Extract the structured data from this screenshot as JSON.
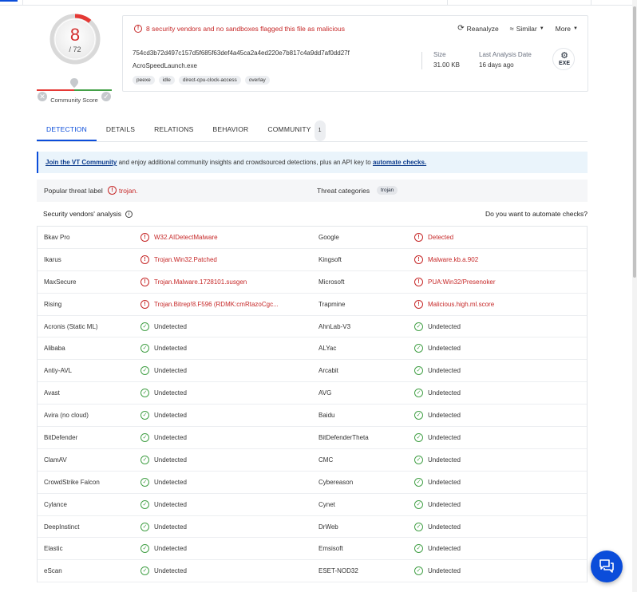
{
  "colors": {
    "accent": "#0b4dda",
    "malicious": "#c62828",
    "clean": "#43a047"
  },
  "score": {
    "value": "8",
    "total": "/ 72",
    "community_label": "Community Score"
  },
  "summary": {
    "alert": "8 security vendors and no sandboxes flagged this file as malicious",
    "actions": {
      "reanalyze": "Reanalyze",
      "similar": "Similar",
      "more": "More"
    },
    "hash": "754cd3b72d497c157d5f685f63def4a45ca2a4ed220e7b817c4a9dd7af0dd27f",
    "filename": "AcroSpeedLaunch.exe",
    "tags": [
      "peexe",
      "idle",
      "direct-cpu-clock-access",
      "overlay"
    ],
    "size_label": "Size",
    "size_value": "31.00 KB",
    "last_analysis_label": "Last Analysis Date",
    "last_analysis_value": "16 days ago",
    "file_type": "EXE"
  },
  "tabs": [
    {
      "label": "DETECTION"
    },
    {
      "label": "DETAILS"
    },
    {
      "label": "RELATIONS"
    },
    {
      "label": "BEHAVIOR"
    },
    {
      "label": "COMMUNITY",
      "count": "1"
    }
  ],
  "banner": {
    "link1": "Join the VT Community",
    "text": " and enjoy additional community insights and crowdsourced detections, plus an API key to ",
    "link2": "automate checks."
  },
  "threat": {
    "label_key": "Popular threat label",
    "label_value": "trojan.",
    "categories_key": "Threat categories",
    "categories_value": "trojan"
  },
  "section": {
    "title": "Security vendors' analysis",
    "automate_question": "Do you want to automate checks?"
  },
  "vendors": [
    {
      "left": {
        "name": "Bkav Pro",
        "result": "W32.AIDetectMalware",
        "status": "malicious"
      },
      "right": {
        "name": "Google",
        "result": "Detected",
        "status": "malicious"
      }
    },
    {
      "left": {
        "name": "Ikarus",
        "result": "Trojan.Win32.Patched",
        "status": "malicious"
      },
      "right": {
        "name": "Kingsoft",
        "result": "Malware.kb.a.902",
        "status": "malicious"
      }
    },
    {
      "left": {
        "name": "MaxSecure",
        "result": "Trojan.Malware.1728101.susgen",
        "status": "malicious"
      },
      "right": {
        "name": "Microsoft",
        "result": "PUA:Win32/Presenoker",
        "status": "malicious"
      }
    },
    {
      "left": {
        "name": "Rising",
        "result": "Trojan.Bitrep!8.F596 (RDMK:cmRtazoCgc...",
        "status": "malicious"
      },
      "right": {
        "name": "Trapmine",
        "result": "Malicious.high.ml.score",
        "status": "malicious"
      }
    },
    {
      "left": {
        "name": "Acronis (Static ML)",
        "result": "Undetected",
        "status": "clean"
      },
      "right": {
        "name": "AhnLab-V3",
        "result": "Undetected",
        "status": "clean"
      }
    },
    {
      "left": {
        "name": "Alibaba",
        "result": "Undetected",
        "status": "clean"
      },
      "right": {
        "name": "ALYac",
        "result": "Undetected",
        "status": "clean"
      }
    },
    {
      "left": {
        "name": "Antiy-AVL",
        "result": "Undetected",
        "status": "clean"
      },
      "right": {
        "name": "Arcabit",
        "result": "Undetected",
        "status": "clean"
      }
    },
    {
      "left": {
        "name": "Avast",
        "result": "Undetected",
        "status": "clean"
      },
      "right": {
        "name": "AVG",
        "result": "Undetected",
        "status": "clean"
      }
    },
    {
      "left": {
        "name": "Avira (no cloud)",
        "result": "Undetected",
        "status": "clean"
      },
      "right": {
        "name": "Baidu",
        "result": "Undetected",
        "status": "clean"
      }
    },
    {
      "left": {
        "name": "BitDefender",
        "result": "Undetected",
        "status": "clean"
      },
      "right": {
        "name": "BitDefenderTheta",
        "result": "Undetected",
        "status": "clean"
      }
    },
    {
      "left": {
        "name": "ClamAV",
        "result": "Undetected",
        "status": "clean"
      },
      "right": {
        "name": "CMC",
        "result": "Undetected",
        "status": "clean"
      }
    },
    {
      "left": {
        "name": "CrowdStrike Falcon",
        "result": "Undetected",
        "status": "clean"
      },
      "right": {
        "name": "Cybereason",
        "result": "Undetected",
        "status": "clean"
      }
    },
    {
      "left": {
        "name": "Cylance",
        "result": "Undetected",
        "status": "clean"
      },
      "right": {
        "name": "Cynet",
        "result": "Undetected",
        "status": "clean"
      }
    },
    {
      "left": {
        "name": "DeepInstinct",
        "result": "Undetected",
        "status": "clean"
      },
      "right": {
        "name": "DrWeb",
        "result": "Undetected",
        "status": "clean"
      }
    },
    {
      "left": {
        "name": "Elastic",
        "result": "Undetected",
        "status": "clean"
      },
      "right": {
        "name": "Emsisoft",
        "result": "Undetected",
        "status": "clean"
      }
    },
    {
      "left": {
        "name": "eScan",
        "result": "Undetected",
        "status": "clean"
      },
      "right": {
        "name": "ESET-NOD32",
        "result": "Undetected",
        "status": "clean"
      }
    }
  ]
}
